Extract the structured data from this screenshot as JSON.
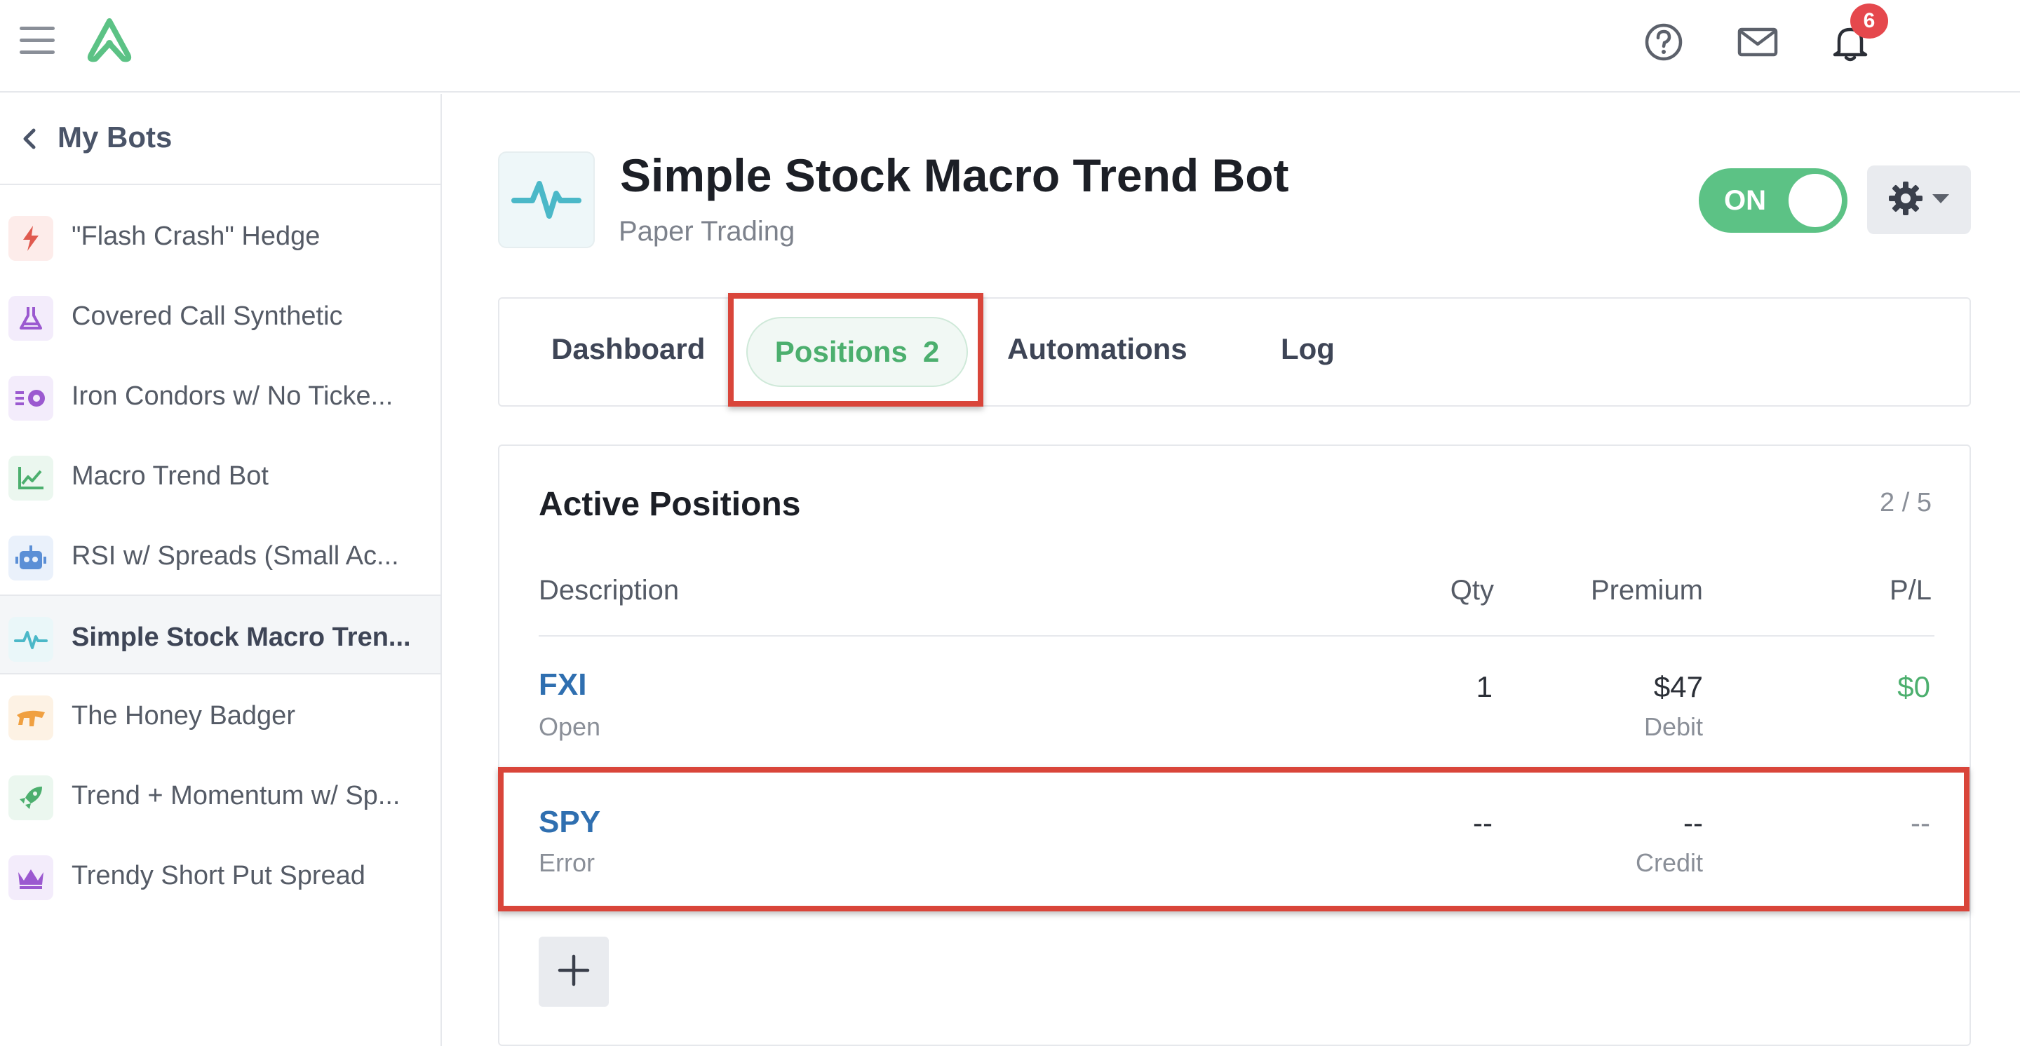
{
  "topbar": {
    "notification_count": "6",
    "icons": [
      "menu-icon",
      "logo-icon",
      "help-icon",
      "mail-icon",
      "bell-icon"
    ]
  },
  "sidebar": {
    "back_label": "My Bots",
    "items": [
      {
        "label": "\"Flash Crash\" Hedge",
        "icon": "lightning-icon",
        "color": "#e05a4f",
        "bg": "#fdecea"
      },
      {
        "label": "Covered Call Synthetic",
        "icon": "flask-icon",
        "color": "#9b59d0",
        "bg": "#f3ecfb"
      },
      {
        "label": "Iron Condors w/ No Ticke...",
        "icon": "dollar-arrows-icon",
        "color": "#9b59d0",
        "bg": "#f3ecfb"
      },
      {
        "label": "Macro Trend Bot",
        "icon": "chart-line-icon",
        "color": "#4caf6e",
        "bg": "#ebf7ef"
      },
      {
        "label": "RSI w/ Spreads (Small Ac...",
        "icon": "robot-icon",
        "color": "#5b8fd6",
        "bg": "#eaf1fb"
      },
      {
        "label": "Simple Stock Macro Tren...",
        "icon": "pulse-icon",
        "color": "#4bb8c8",
        "bg": "#eaf7f9",
        "active": true
      },
      {
        "label": "The Honey Badger",
        "icon": "badger-icon",
        "color": "#f0a040",
        "bg": "#fdf2e4"
      },
      {
        "label": "Trend + Momentum w/ Sp...",
        "icon": "rocket-icon",
        "color": "#4caf6e",
        "bg": "#ebf7ef"
      },
      {
        "label": "Trendy Short Put Spread",
        "icon": "crown-icon",
        "color": "#9b59d0",
        "bg": "#f3ecfb"
      }
    ]
  },
  "bot": {
    "title": "Simple Stock Macro Trend Bot",
    "subtitle": "Paper Trading",
    "toggle_label": "ON",
    "accent": "#5cc285"
  },
  "tabs": {
    "dashboard": "Dashboard",
    "positions": "Positions",
    "positions_count": "2",
    "automations": "Automations",
    "log": "Log"
  },
  "positions": {
    "title": "Active Positions",
    "count": "2 / 5",
    "headers": {
      "description": "Description",
      "qty": "Qty",
      "premium": "Premium",
      "pl": "P/L"
    },
    "rows": [
      {
        "symbol": "FXI",
        "status": "Open",
        "qty": "1",
        "premium": "$47",
        "premium_type": "Debit",
        "pl": "$0"
      },
      {
        "symbol": "SPY",
        "status": "Error",
        "qty": "--",
        "premium": "--",
        "premium_type": "Credit",
        "pl": "--"
      }
    ]
  }
}
